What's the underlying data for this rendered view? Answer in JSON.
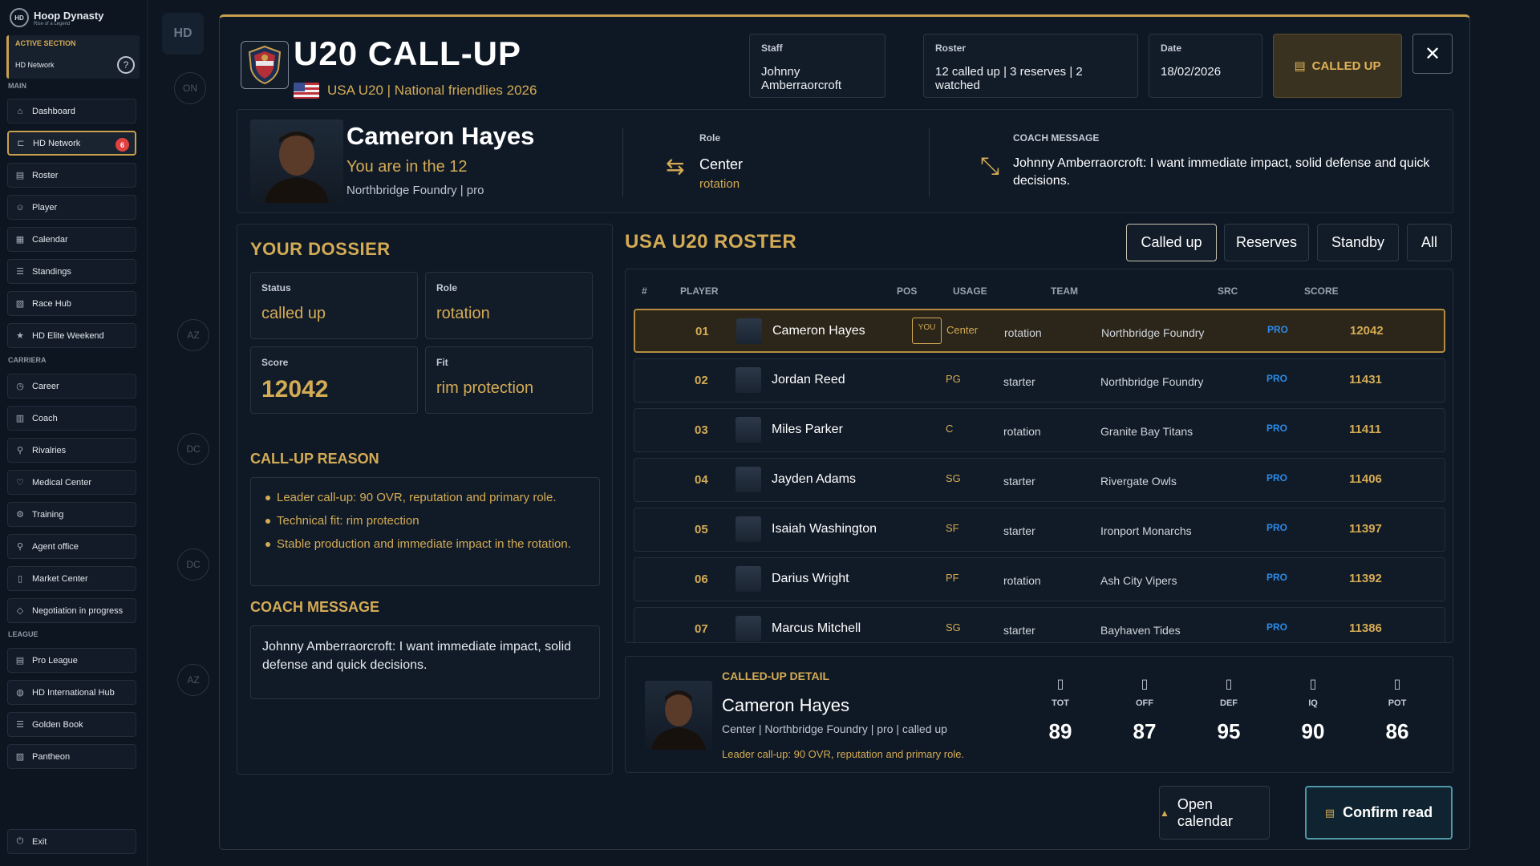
{
  "app": {
    "name": "Hoop Dynasty",
    "tagline": "Rise of a Legend",
    "logo_text": "HD"
  },
  "active_section": {
    "label": "ACTIVE SECTION",
    "value": "HD Network",
    "help_icon": "?"
  },
  "sidebar": {
    "main_label": "MAIN",
    "main": [
      {
        "label": "Dashboard",
        "icon": "home-icon"
      },
      {
        "label": "HD Network",
        "icon": "network-icon",
        "badge": "6",
        "active": true
      },
      {
        "label": "Roster",
        "icon": "roster-icon"
      },
      {
        "label": "Player",
        "icon": "user-icon"
      },
      {
        "label": "Calendar",
        "icon": "calendar-icon"
      },
      {
        "label": "Standings",
        "icon": "list-icon"
      },
      {
        "label": "Race Hub",
        "icon": "race-icon"
      },
      {
        "label": "HD Elite Weekend",
        "icon": "star-icon"
      }
    ],
    "carriera_label": "CARRIERA",
    "carriera": [
      {
        "label": "Career",
        "icon": "history-icon"
      },
      {
        "label": "Coach",
        "icon": "coach-icon"
      },
      {
        "label": "Rivalries",
        "icon": "search-icon"
      },
      {
        "label": "Medical Center",
        "icon": "heart-icon"
      },
      {
        "label": "Training",
        "icon": "training-icon"
      },
      {
        "label": "Agent office",
        "icon": "agent-icon"
      },
      {
        "label": "Market Center",
        "icon": "market-icon"
      },
      {
        "label": "Negotiation in progress",
        "icon": "tag-icon"
      }
    ],
    "league_label": "LEAGUE",
    "league": [
      {
        "label": "Pro League",
        "icon": "league-icon"
      },
      {
        "label": "HD International Hub",
        "icon": "globe-icon"
      },
      {
        "label": "Golden Book",
        "icon": "book-icon"
      },
      {
        "label": "Pantheon",
        "icon": "pantheon-icon"
      }
    ],
    "exit": "Exit"
  },
  "background": {
    "hd": "HD",
    "on": "ON",
    "circles": [
      "AZ",
      "DC",
      "DC",
      "AZ"
    ]
  },
  "modal": {
    "title": "U20 CALL-UP",
    "subtitle": "USA U20 | National friendlies 2026",
    "staff": {
      "label": "Staff",
      "value": "Johnny Amberraorcroft"
    },
    "roster_info": {
      "label": "Roster",
      "value": "12 called up | 3 reserves | 2 watched"
    },
    "date": {
      "label": "Date",
      "value": "18/02/2026"
    },
    "status_btn": "CALLED UP",
    "close": "✕"
  },
  "hero": {
    "name": "Cameron Hayes",
    "tagline": "You are in the 12",
    "team": "Northbridge Foundry | pro",
    "role_label": "Role",
    "role_value": "Center",
    "role_sub": "rotation",
    "coach_label": "COACH MESSAGE",
    "coach_msg": "Johnny Amberraorcroft: I want immediate impact, solid defense and quick decisions."
  },
  "dossier": {
    "title": "YOUR DOSSIER",
    "status": {
      "label": "Status",
      "value": "called up"
    },
    "role": {
      "label": "Role",
      "value": "rotation"
    },
    "score": {
      "label": "Score",
      "value": "12042"
    },
    "fit": {
      "label": "Fit",
      "value": "rim protection"
    },
    "reason_title": "CALL-UP REASON",
    "reasons": [
      "Leader call-up: 90 OVR, reputation and primary role.",
      "Technical fit: rim protection",
      "Stable production and immediate impact in the rotation."
    ],
    "coach_title": "COACH MESSAGE",
    "coach_msg": "Johnny Amberraorcroft: I want immediate impact, solid defense and quick decisions."
  },
  "roster": {
    "title": "USA U20 ROSTER",
    "filters": [
      "Called up",
      "Reserves",
      "Standby",
      "All"
    ],
    "headers": [
      "#",
      "PLAYER",
      "POS",
      "USAGE",
      "TEAM",
      "SRC",
      "SCORE"
    ],
    "you_tag": "YOU",
    "rows": [
      {
        "num": "01",
        "name": "Cameron Hayes",
        "pos": "Center",
        "usage": "rotation",
        "team": "Northbridge Foundry",
        "src": "PRO",
        "score": "12042",
        "me": true
      },
      {
        "num": "02",
        "name": "Jordan Reed",
        "pos": "PG",
        "usage": "starter",
        "team": "Northbridge Foundry",
        "src": "PRO",
        "score": "11431"
      },
      {
        "num": "03",
        "name": "Miles Parker",
        "pos": "C",
        "usage": "rotation",
        "team": "Granite Bay Titans",
        "src": "PRO",
        "score": "11411"
      },
      {
        "num": "04",
        "name": "Jayden Adams",
        "pos": "SG",
        "usage": "starter",
        "team": "Rivergate Owls",
        "src": "PRO",
        "score": "11406"
      },
      {
        "num": "05",
        "name": "Isaiah Washington",
        "pos": "SF",
        "usage": "starter",
        "team": "Ironport Monarchs",
        "src": "PRO",
        "score": "11397"
      },
      {
        "num": "06",
        "name": "Darius Wright",
        "pos": "PF",
        "usage": "rotation",
        "team": "Ash City Vipers",
        "src": "PRO",
        "score": "11392"
      },
      {
        "num": "07",
        "name": "Marcus Mitchell",
        "pos": "SG",
        "usage": "starter",
        "team": "Bayhaven Tides",
        "src": "PRO",
        "score": "11386"
      }
    ]
  },
  "detail": {
    "label": "CALLED-UP DETAIL",
    "name": "Cameron Hayes",
    "sub": "Center | Northbridge Foundry | pro | called up",
    "reason": "Leader call-up: 90 OVR, reputation and primary role.",
    "stats": [
      {
        "label": "TOT",
        "value": "89"
      },
      {
        "label": "OFF",
        "value": "87"
      },
      {
        "label": "DEF",
        "value": "95"
      },
      {
        "label": "IQ",
        "value": "90"
      },
      {
        "label": "POT",
        "value": "86"
      }
    ]
  },
  "actions": {
    "calendar": "Open calendar",
    "confirm": "Confirm read"
  },
  "colors": {
    "accent_gold": "#d4ab55",
    "src_blue": "#2b8be8",
    "badge_red": "#e0413f",
    "confirm_border": "#4f98a8"
  }
}
